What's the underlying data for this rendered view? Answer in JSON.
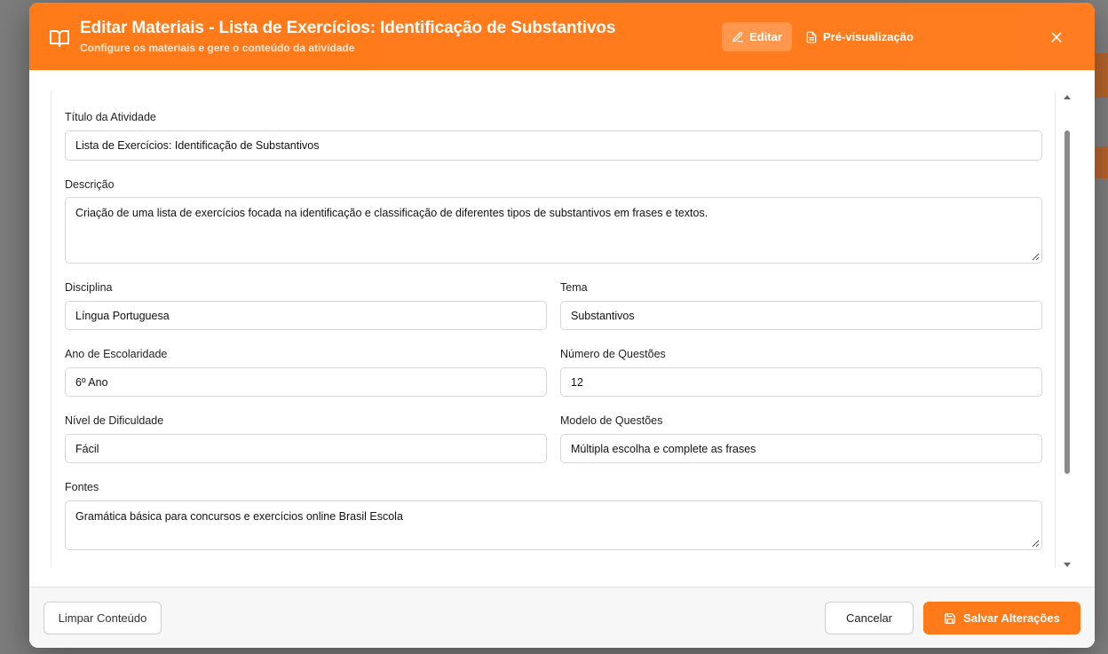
{
  "header": {
    "icon": "book-open-icon",
    "title": "Editar Materiais - Lista de Exercícios: Identificação de Substantivos",
    "subtitle": "Configure os materiais e gere o conteúdo da atividade",
    "tabs": {
      "edit_label": "Editar",
      "edit_icon": "pencil-icon",
      "preview_label": "Pré-visualização",
      "preview_icon": "document-icon"
    },
    "close_icon": "close-icon",
    "accent_color": "#ff7a18"
  },
  "form": {
    "titulo": {
      "label": "Título da Atividade",
      "value": "Lista de Exercícios: Identificação de Substantivos"
    },
    "descricao": {
      "label": "Descrição",
      "value": "Criação de uma lista de exercícios focada na identificação e classificação de diferentes tipos de substantivos em frases e textos."
    },
    "disciplina": {
      "label": "Disciplina",
      "value": "Língua Portuguesa"
    },
    "tema": {
      "label": "Tema",
      "value": "Substantivos"
    },
    "ano": {
      "label": "Ano de Escolaridade",
      "value": "6º Ano"
    },
    "num_questoes": {
      "label": "Número de Questões",
      "value": "12"
    },
    "dificuldade": {
      "label": "Nível de Dificuldade",
      "value": "Fácil"
    },
    "modelo": {
      "label": "Modelo de Questões",
      "value": "Múltipla escolha e complete as frases"
    },
    "fontes": {
      "label": "Fontes",
      "value": "Gramática básica para concursos e exercícios online Brasil Escola"
    }
  },
  "footer": {
    "clear_label": "Limpar Conteúdo",
    "cancel_label": "Cancelar",
    "save_label": "Salvar Alterações",
    "save_icon": "save-icon"
  }
}
